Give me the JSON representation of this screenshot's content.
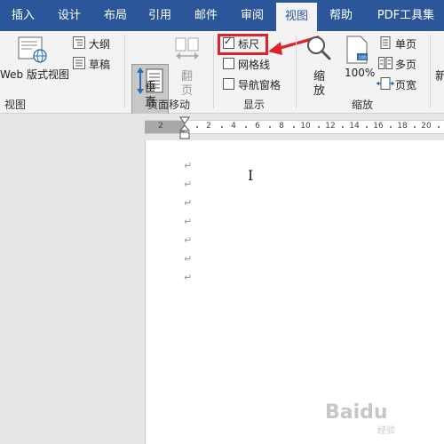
{
  "tabs": [
    "插入",
    "设计",
    "布局",
    "引用",
    "邮件",
    "审阅",
    "视图",
    "帮助",
    "PDF工具集"
  ],
  "ribbon": {
    "view_group": {
      "web_label": "Web 版式视图",
      "outline_label": "大纲",
      "draft_label": "草稿",
      "group_label": "视图"
    },
    "page_move_group": {
      "vertical_label_1": "垂",
      "vertical_label_2": "直",
      "flip_label_1": "翻",
      "flip_label_2": "页",
      "group_label": "页面移动"
    },
    "show_group": {
      "ruler_label": "标尺",
      "ruler_checked": true,
      "gridlines_label": "网格线",
      "gridlines_checked": false,
      "nav_pane_label": "导航窗格",
      "nav_pane_checked": false,
      "group_label": "显示"
    },
    "zoom_group": {
      "zoom_label_1": "缩",
      "zoom_label_2": "放",
      "percent_label": "100%",
      "one_page_label": "单页",
      "multi_page_label": "多页",
      "page_width_label": "页宽",
      "group_label": "缩放"
    },
    "overflow_label": "新"
  },
  "ruler": {
    "ticks": [
      "2",
      "2",
      "4",
      "6",
      "8",
      "10",
      "12",
      "14",
      "16",
      "18",
      "20"
    ]
  },
  "document": {
    "paragraph_mark": "↵",
    "cursor": "I"
  },
  "watermark": {
    "text": "Baidu",
    "sub": "经验"
  },
  "colors": {
    "tabbar": "#2b579a",
    "ribbon": "#f3f3f3",
    "highlight": "#e0222a"
  },
  "icons": [
    "web-layout-icon",
    "outline-icon",
    "draft-icon",
    "vertical-icon",
    "flip-icon",
    "magnifier-icon",
    "zoom-100-icon",
    "one-page-icon",
    "multi-page-icon",
    "page-width-icon",
    "red-arrow-icon"
  ]
}
